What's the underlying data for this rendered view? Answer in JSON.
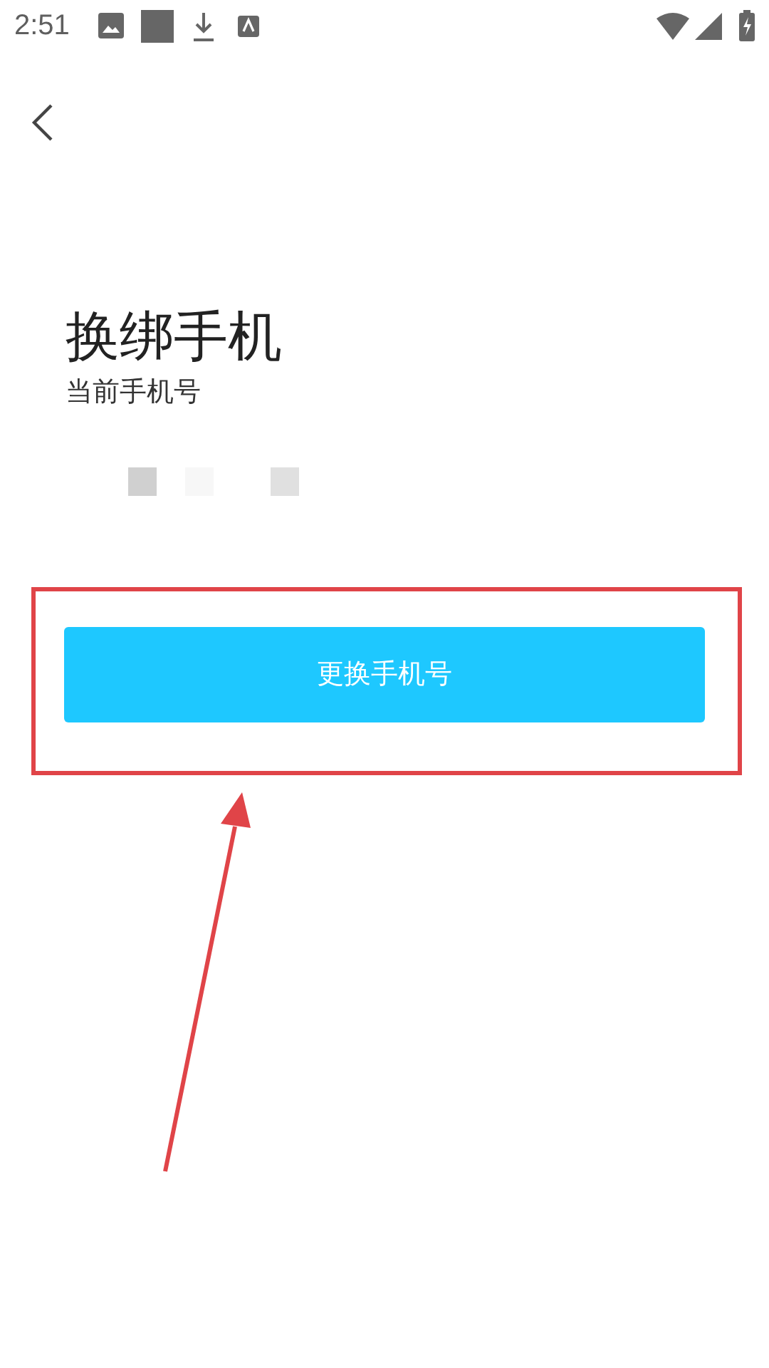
{
  "status_bar": {
    "time": "2:51"
  },
  "page": {
    "title": "换绑手机",
    "subtitle": "当前手机号"
  },
  "button": {
    "label": "更换手机号"
  }
}
